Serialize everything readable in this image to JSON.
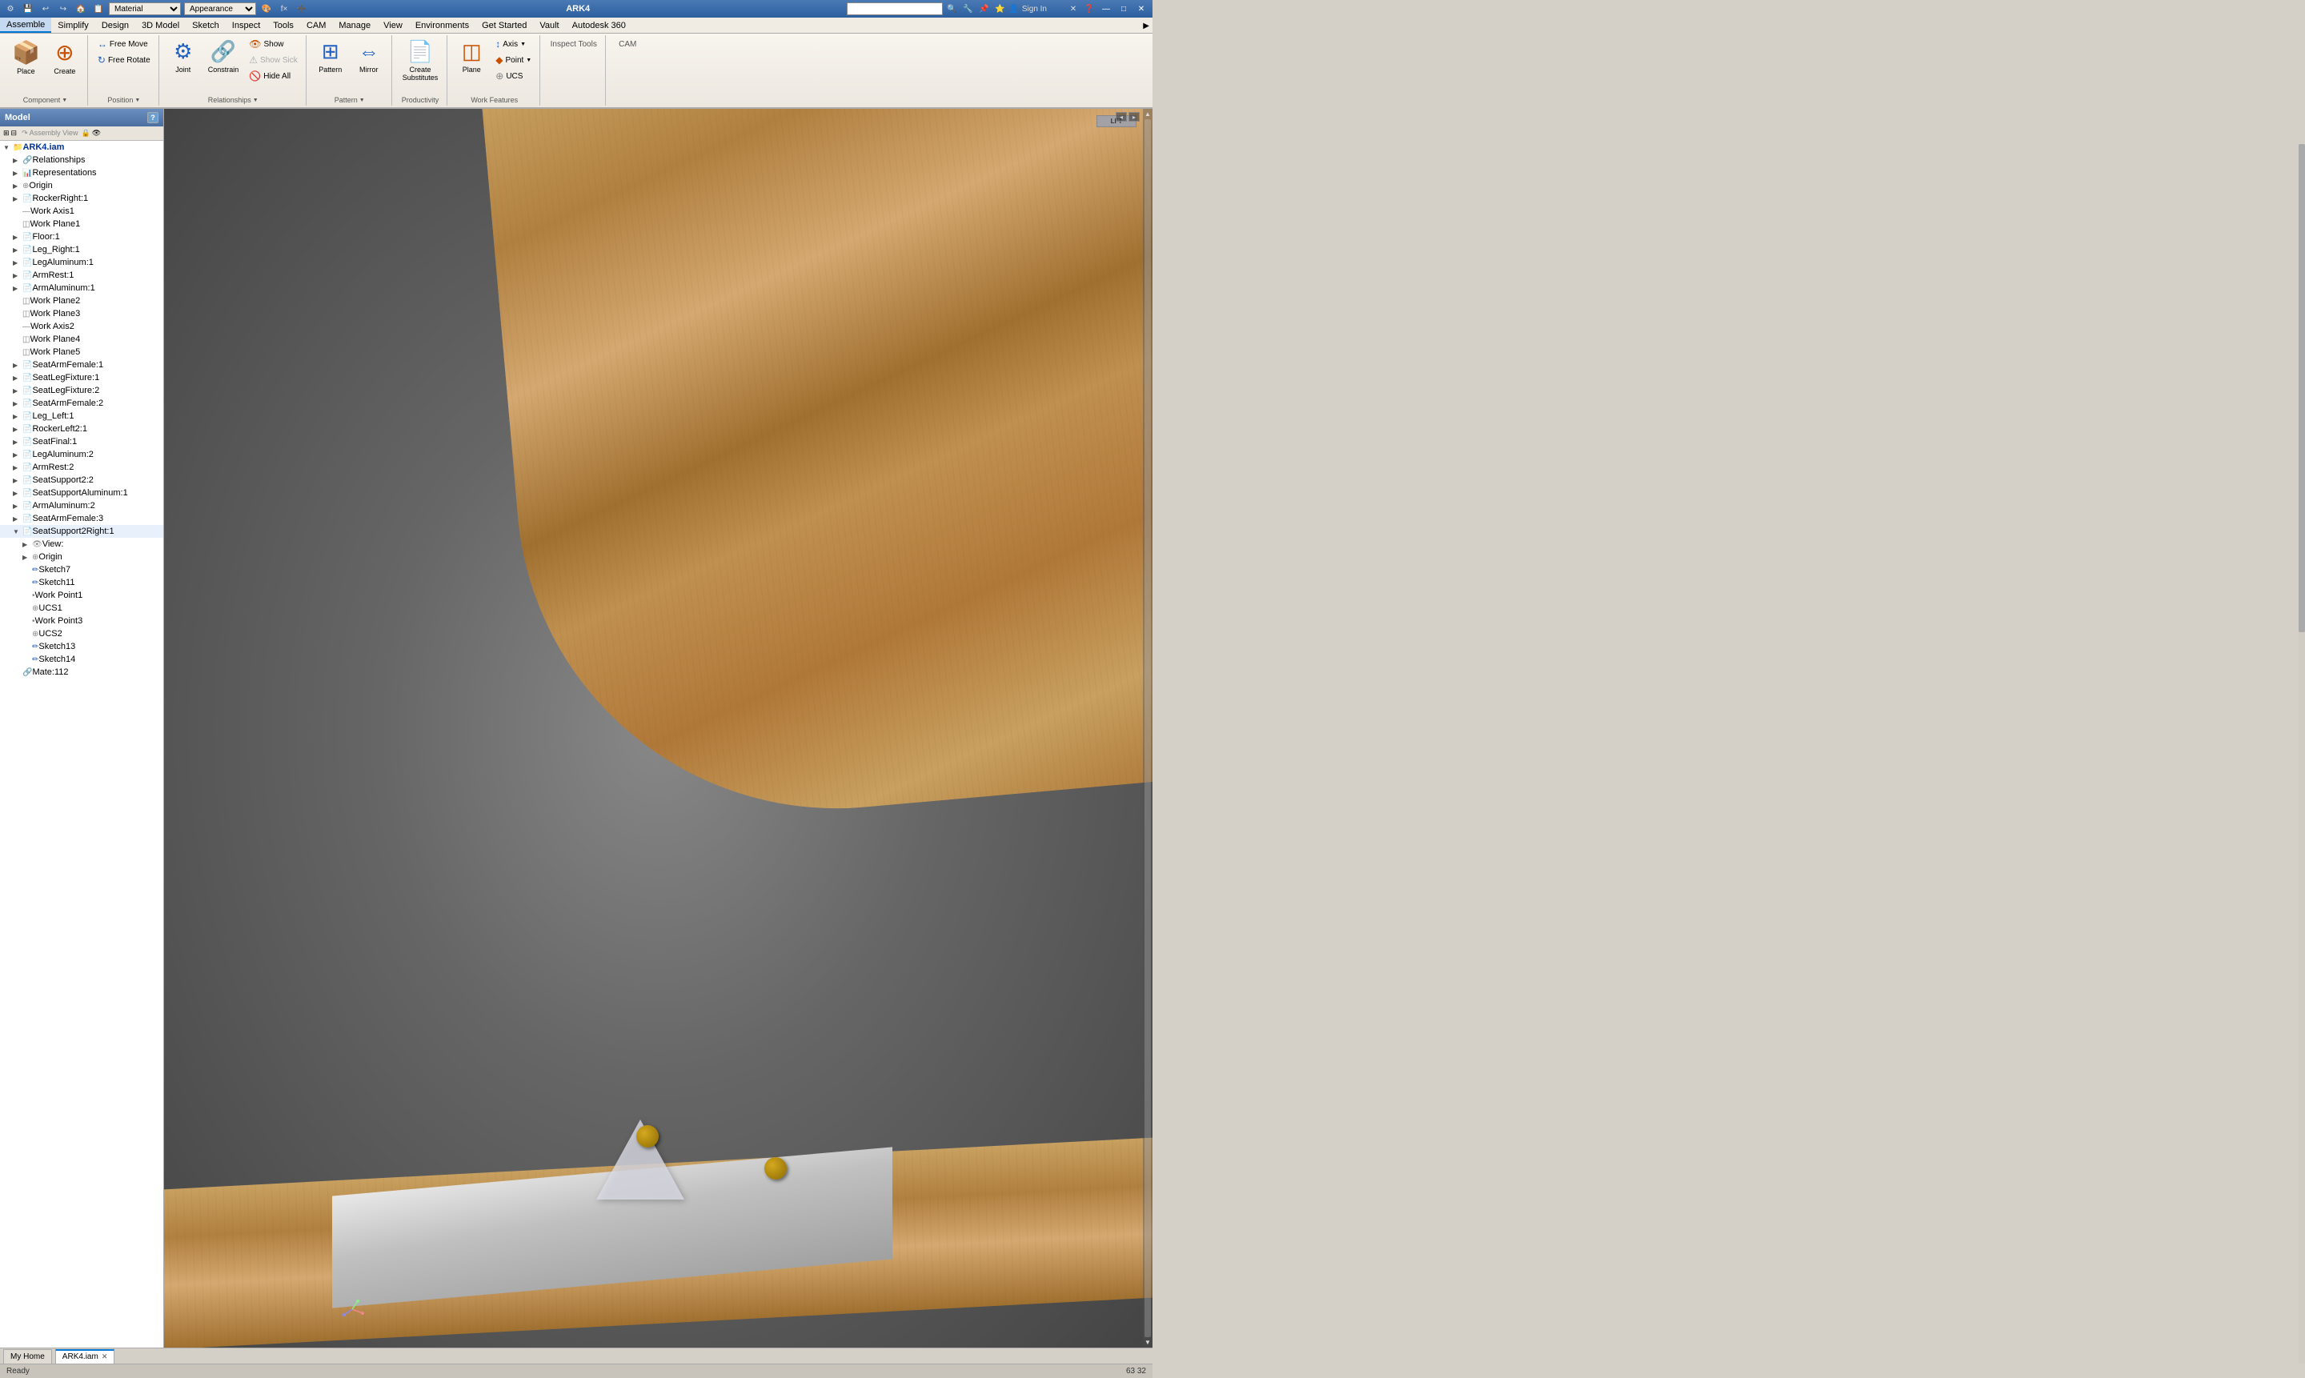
{
  "titlebar": {
    "title": "ARK4",
    "app_icon": "⚙",
    "quick_access": [
      "💾",
      "↩",
      "↪",
      "🏠",
      "📋"
    ],
    "material_label": "Material",
    "appearance_label": "Appearance",
    "search_placeholder": "",
    "sign_in": "Sign In",
    "minimize": "—",
    "maximize": "□",
    "close": "✕"
  },
  "menubar": {
    "items": [
      {
        "label": "Assemble",
        "active": true
      },
      {
        "label": "Simplify",
        "active": false
      },
      {
        "label": "Design",
        "active": false
      },
      {
        "label": "3D Model",
        "active": false
      },
      {
        "label": "Sketch",
        "active": false
      },
      {
        "label": "Inspect",
        "active": false
      },
      {
        "label": "Tools",
        "active": false
      },
      {
        "label": "CAM",
        "active": false
      },
      {
        "label": "Manage",
        "active": false
      },
      {
        "label": "View",
        "active": false
      },
      {
        "label": "Environments",
        "active": false
      },
      {
        "label": "Get Started",
        "active": false
      },
      {
        "label": "Vault",
        "active": false
      },
      {
        "label": "Autodesk 360",
        "active": false
      }
    ]
  },
  "ribbon": {
    "component_group": {
      "label": "Component",
      "place_label": "Place",
      "create_label": "Create"
    },
    "position_group": {
      "label": "Position",
      "free_move_label": "Free Move",
      "free_rotate_label": "Free Rotate"
    },
    "relationships_group": {
      "label": "Relationships",
      "joint_label": "Joint",
      "constrain_label": "Constrain",
      "show_label": "Show",
      "show_sick_label": "Show Sick",
      "hide_all_label": "Hide All"
    },
    "pattern_group": {
      "label": "Pattern",
      "pattern_label": "Pattern",
      "mirror_label": "Mirror"
    },
    "productivity_group": {
      "label": "Productivity",
      "create_substitutes_label": "Create\nSubstitutes"
    },
    "work_features_group": {
      "label": "Work Features",
      "plane_label": "Plane",
      "axis_label": "Axis",
      "point_label": "Point",
      "ucs_label": "UCS"
    },
    "inspect_tools_label": "Inspect Tools",
    "cam_label": "CAM"
  },
  "model_panel": {
    "title": "Model",
    "help_icon": "?",
    "view_label": "Assembly View",
    "root": "ARK4.iam",
    "tree_items": [
      {
        "label": "Relationships",
        "level": 1,
        "type": "relationship",
        "expanded": false
      },
      {
        "label": "Representations",
        "level": 1,
        "type": "representation",
        "expanded": false
      },
      {
        "label": "Origin",
        "level": 1,
        "type": "origin",
        "expanded": false
      },
      {
        "label": "RockerRight:1",
        "level": 1,
        "type": "component"
      },
      {
        "label": "Work Axis1",
        "level": 1,
        "type": "workaxis"
      },
      {
        "label": "Work Plane1",
        "level": 1,
        "type": "workplane"
      },
      {
        "label": "Floor:1",
        "level": 1,
        "type": "component"
      },
      {
        "label": "Leg_Right:1",
        "level": 1,
        "type": "component"
      },
      {
        "label": "LegAluminum:1",
        "level": 1,
        "type": "component"
      },
      {
        "label": "ArmRest:1",
        "level": 1,
        "type": "component"
      },
      {
        "label": "ArmAluminum:1",
        "level": 1,
        "type": "component"
      },
      {
        "label": "Work Plane2",
        "level": 1,
        "type": "workplane"
      },
      {
        "label": "Work Plane3",
        "level": 1,
        "type": "workplane"
      },
      {
        "label": "Work Axis2",
        "level": 1,
        "type": "workaxis"
      },
      {
        "label": "Work Plane4",
        "level": 1,
        "type": "workplane"
      },
      {
        "label": "Work Plane5",
        "level": 1,
        "type": "workplane"
      },
      {
        "label": "SeatArmFemale:1",
        "level": 1,
        "type": "component"
      },
      {
        "label": "SeatLegFixture:1",
        "level": 1,
        "type": "component"
      },
      {
        "label": "SeatLegFixture:2",
        "level": 1,
        "type": "component"
      },
      {
        "label": "SeatArmFemale:2",
        "level": 1,
        "type": "component"
      },
      {
        "label": "Leg_Left:1",
        "level": 1,
        "type": "component"
      },
      {
        "label": "RockerLeft2:1",
        "level": 1,
        "type": "component"
      },
      {
        "label": "SeatFinal:1",
        "level": 1,
        "type": "component"
      },
      {
        "label": "LegAluminum:2",
        "level": 1,
        "type": "component"
      },
      {
        "label": "ArmRest:2",
        "level": 1,
        "type": "component"
      },
      {
        "label": "SeatSupport2:2",
        "level": 1,
        "type": "component"
      },
      {
        "label": "SeatSupportAluminum:1",
        "level": 1,
        "type": "component"
      },
      {
        "label": "ArmAluminum:2",
        "level": 1,
        "type": "component"
      },
      {
        "label": "SeatArmFemale:3",
        "level": 1,
        "type": "component"
      },
      {
        "label": "SeatSupport2Right:1",
        "level": 1,
        "type": "component",
        "expanded": true
      },
      {
        "label": "View:",
        "level": 2,
        "type": "view"
      },
      {
        "label": "Origin",
        "level": 2,
        "type": "origin"
      },
      {
        "label": "Sketch7",
        "level": 2,
        "type": "sketch"
      },
      {
        "label": "Sketch11",
        "level": 2,
        "type": "sketch"
      },
      {
        "label": "Work Point1",
        "level": 2,
        "type": "workpoint"
      },
      {
        "label": "UCS1",
        "level": 2,
        "type": "ucs"
      },
      {
        "label": "Work Point3",
        "level": 2,
        "type": "workpoint"
      },
      {
        "label": "UCS2",
        "level": 2,
        "type": "ucs"
      },
      {
        "label": "Sketch13",
        "level": 2,
        "type": "sketch"
      },
      {
        "label": "Sketch14",
        "level": 2,
        "type": "sketch"
      },
      {
        "label": "Mate:112",
        "level": 1,
        "type": "mate"
      }
    ]
  },
  "context_panel": {
    "relationships_label": "Relationships",
    "level_indicator": ""
  },
  "viewport": {
    "nav_cube_label": "LFT",
    "coord_display": "63 32"
  },
  "bottom_tabs": [
    {
      "label": "My Home",
      "active": false,
      "closeable": false
    },
    {
      "label": "ARK4.iam",
      "active": true,
      "closeable": true
    }
  ],
  "statusbar": {
    "ready_label": "Ready",
    "coords": "63  32"
  }
}
